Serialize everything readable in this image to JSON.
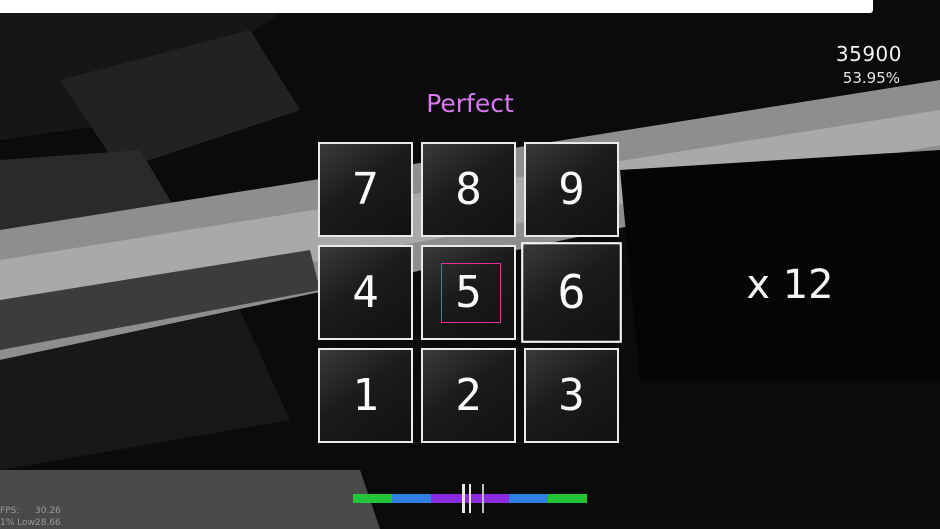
{
  "hud": {
    "score": "35900",
    "accuracy": "53.95%",
    "judgement": "Perfect",
    "combo": "x 12"
  },
  "grid": {
    "tiles": [
      "7",
      "8",
      "9",
      "4",
      "5",
      "6",
      "1",
      "2",
      "3"
    ],
    "active_target": "5"
  },
  "stats": {
    "fps_label": "FPS:",
    "fps_value": "30.26",
    "low_label": "1% Low:",
    "low_value": "28.66"
  },
  "colors": {
    "judgement": "#d978f0",
    "target_outline": "#e0309a",
    "timing_good": "#22c43a",
    "timing_great": "#2f7fe0",
    "timing_perfect": "#8a2be2"
  }
}
